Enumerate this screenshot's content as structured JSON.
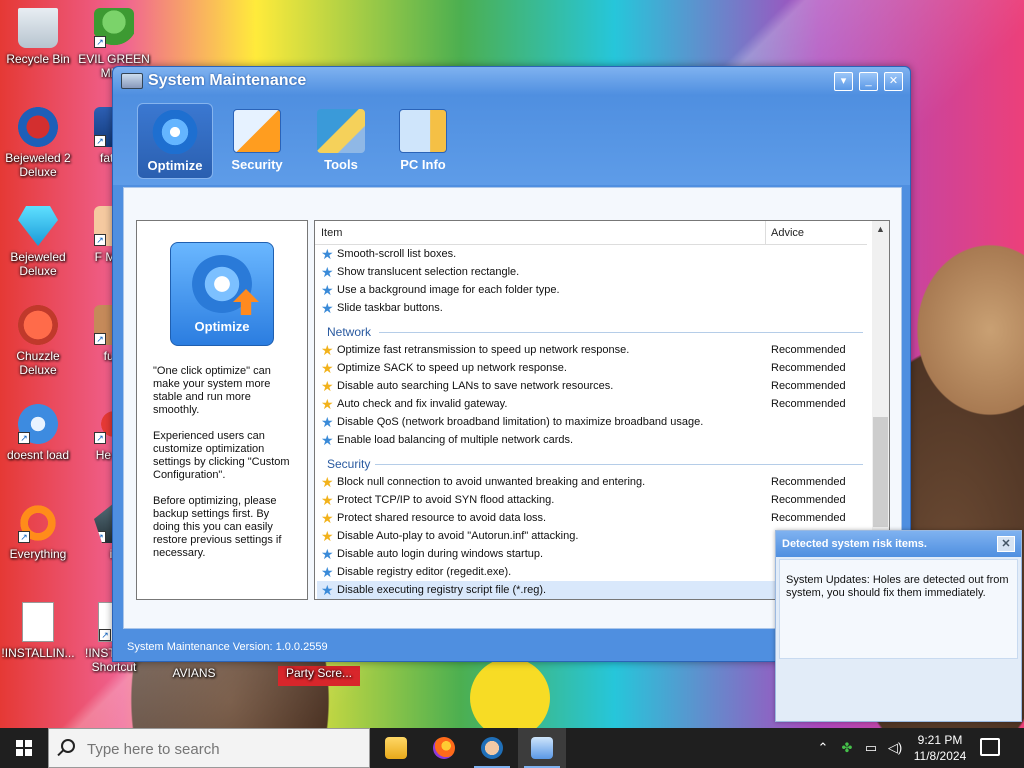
{
  "desktop": {
    "icons": [
      {
        "label": "Recycle Bin",
        "name": "recycle-bin"
      },
      {
        "label": "EVIL GREEN MEN",
        "name": "evil-green-men"
      },
      {
        "label": "Bejeweled 2 Deluxe",
        "name": "bejeweled-2-deluxe"
      },
      {
        "label": "fat lik",
        "name": "fat-lik"
      },
      {
        "label": "Bejeweled Deluxe",
        "name": "bejeweled-deluxe"
      },
      {
        "label": "F MON",
        "name": "f-mon"
      },
      {
        "label": "Chuzzle Deluxe",
        "name": "chuzzle-deluxe"
      },
      {
        "label": "furn",
        "name": "furn"
      },
      {
        "label": "doesnt load",
        "name": "doesnt-load"
      },
      {
        "label": "He We",
        "name": "he-we"
      },
      {
        "label": "Everything",
        "name": "everything"
      },
      {
        "label": "is",
        "name": "is"
      },
      {
        "label": "!INSTALLIN...",
        "name": "installing-1"
      },
      {
        "label": "!INSTALL - Shortcut",
        "name": "installing-shortcut"
      },
      {
        "label": "AVIANS",
        "name": "avians"
      },
      {
        "label": "Party Scre...",
        "name": "party-screen"
      }
    ]
  },
  "window": {
    "title": "System Maintenance",
    "controls": {
      "menu": "▾",
      "minimize": "_",
      "close": "✕"
    }
  },
  "toolbar": {
    "tabs": [
      {
        "label": "Optimize",
        "icon": "optimize-gear-icon",
        "active": true
      },
      {
        "label": "Security",
        "icon": "security-shield-icon",
        "active": false
      },
      {
        "label": "Tools",
        "icon": "tools-icon",
        "active": false
      },
      {
        "label": "PC Info",
        "icon": "pc-info-icon",
        "active": false
      }
    ]
  },
  "left_panel": {
    "button_label": "Optimize",
    "desc1": "\"One click optimize\" can make your system more stable and run more smoothly.",
    "desc2": "Experienced users can customize optimization settings by clicking \"Custom Configuration\".",
    "desc3": "Before optimizing, please backup settings first. By doing this you can easily restore previous settings if necessary."
  },
  "list": {
    "columns": {
      "item": "Item",
      "advice": "Advice"
    },
    "groups": {
      "network": "Network",
      "security": "Security"
    },
    "rows_top": [
      {
        "text": "Smooth-scroll list boxes.",
        "advice": "",
        "star": "blue"
      },
      {
        "text": "Show translucent selection rectangle.",
        "advice": "",
        "star": "blue"
      },
      {
        "text": "Use a background image for each folder type.",
        "advice": "",
        "star": "blue"
      },
      {
        "text": "Slide taskbar buttons.",
        "advice": "",
        "star": "blue"
      }
    ],
    "rows_network": [
      {
        "text": "Optimize fast retransmission to speed up network response.",
        "advice": "Recommended",
        "star": "gold"
      },
      {
        "text": "Optimize SACK to speed up network response.",
        "advice": "Recommended",
        "star": "gold"
      },
      {
        "text": "Disable auto searching LANs to save network resources.",
        "advice": "Recommended",
        "star": "gold"
      },
      {
        "text": "Auto check and fix invalid gateway.",
        "advice": "Recommended",
        "star": "gold"
      },
      {
        "text": "Disable QoS (network broadband limitation) to maximize broadband usage.",
        "advice": "",
        "star": "blue"
      },
      {
        "text": "Enable load balancing of multiple network cards.",
        "advice": "",
        "star": "blue"
      }
    ],
    "rows_security": [
      {
        "text": "Block null connection to avoid unwanted breaking and entering.",
        "advice": "Recommended",
        "star": "gold"
      },
      {
        "text": "Protect TCP/IP to avoid SYN flood attacking.",
        "advice": "Recommended",
        "star": "gold"
      },
      {
        "text": "Protect shared resource to avoid data loss.",
        "advice": "Recommended",
        "star": "gold"
      },
      {
        "text": "Disable Auto-play to avoid \"Autorun.inf\" attacking.",
        "advice": "",
        "star": "gold"
      },
      {
        "text": "Disable auto login during windows startup.",
        "advice": "",
        "star": "blue"
      },
      {
        "text": "Disable registry editor (regedit.exe).",
        "advice": "",
        "star": "blue"
      },
      {
        "text": "Disable executing registry script file (*.reg).",
        "advice": "",
        "star": "blue"
      }
    ]
  },
  "status": {
    "version_text": "System Maintenance Version: 1.0.0.2559"
  },
  "notification": {
    "title": "Detected system risk items.",
    "close": "✕",
    "body": "System Updates: Holes are detected out from system, you should fix them immediately."
  },
  "taskbar": {
    "search_placeholder": "Type here to search",
    "apps": [
      "file-explorer",
      "firefox",
      "cartoon-app",
      "system-maintenance"
    ],
    "time": "9:21 PM",
    "date": "11/8/2024"
  },
  "colors": {
    "accent": "#4f8fe0",
    "star_gold": "#f2b21b",
    "star_blue": "#3a8ad8",
    "group_text": "#2a5aa0"
  }
}
